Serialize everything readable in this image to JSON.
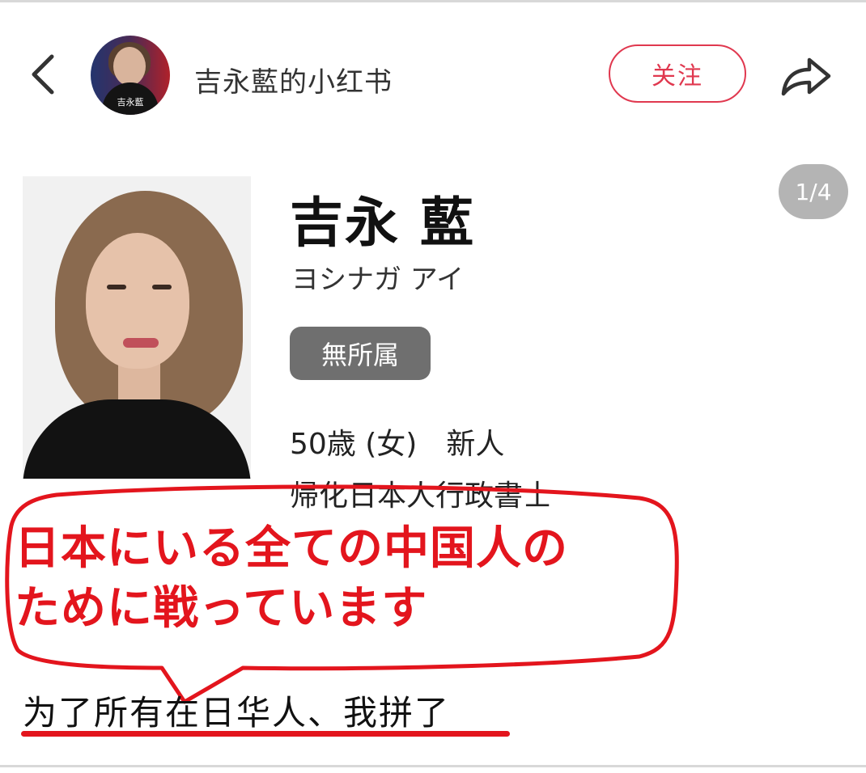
{
  "header": {
    "account_name": "吉永藍的小红书",
    "follow_label": "关注",
    "avatar_caption": "吉永藍"
  },
  "icons": {
    "back": "chevron-left-icon",
    "share": "share-arrow-icon"
  },
  "content": {
    "page_indicator": "1/4",
    "candidate": {
      "name": "吉永 藍",
      "kana": "ヨシナガ アイ",
      "party": "無所属",
      "age_line": "50歳 (女)　新人",
      "occupation": "帰化日本人行政書士"
    },
    "annotation": {
      "line1": "日本にいる全ての中国人の",
      "line2": "ために戦っています"
    },
    "caption": "为了所有在日华人、我拼了"
  },
  "colors": {
    "accent_red": "#e3151d",
    "follow_red": "#e0384f",
    "badge_gray": "#6f6f6f",
    "indicator_gray": "#b4b4b4"
  }
}
